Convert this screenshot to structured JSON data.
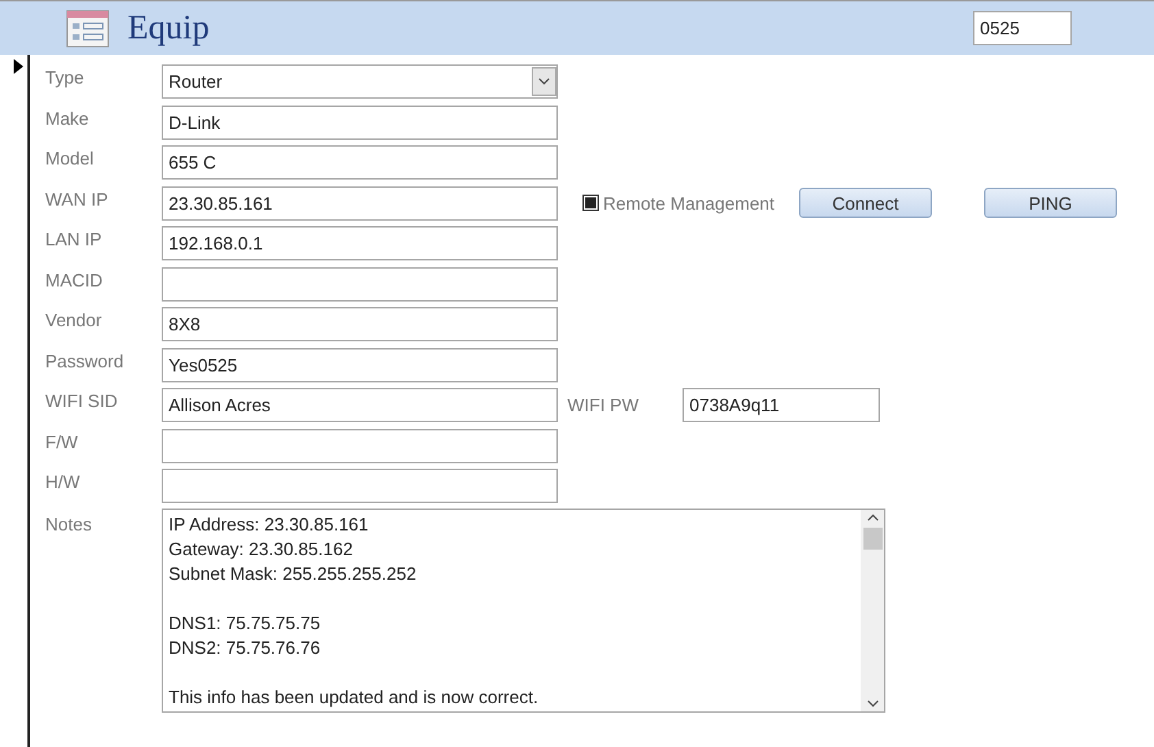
{
  "header": {
    "title": "Equip",
    "record_id": "0525"
  },
  "fields": [
    {
      "label": "Type",
      "kind": "combo",
      "value": "Router"
    },
    {
      "label": "Make",
      "kind": "text",
      "value": "D-Link"
    },
    {
      "label": "Model",
      "kind": "text",
      "value": "655 C"
    },
    {
      "label": "WAN IP",
      "kind": "text",
      "value": "23.30.85.161",
      "extra": {
        "kind": "actions",
        "checkbox": {
          "label": "Remote Management",
          "checked": true
        },
        "buttons": [
          "Connect",
          "PING"
        ]
      }
    },
    {
      "label": "LAN IP",
      "kind": "text",
      "value": "192.168.0.1"
    },
    {
      "label": "MACID",
      "kind": "text"
    },
    {
      "label": "Vendor",
      "kind": "text",
      "value": "8X8"
    },
    {
      "label": "Password",
      "kind": "text",
      "value": "Yes0525"
    },
    {
      "label": "WIFI SID",
      "kind": "text",
      "value": "Allison Acres",
      "extra": {
        "kind": "field",
        "label": "WIFI PW",
        "value": "0738A9q11"
      }
    },
    {
      "label": "F/W",
      "kind": "text"
    },
    {
      "label": "H/W",
      "kind": "text"
    }
  ],
  "notes": {
    "label": "Notes",
    "paragraphs": [
      [
        "IP Address: 23.30.85.161",
        "Gateway: 23.30.85.162",
        "Subnet Mask: 255.255.255.252"
      ],
      [
        "DNS1: 75.75.75.75",
        "DNS2: 75.75.76.76"
      ],
      [
        "This info has been updated and is now correct."
      ]
    ]
  }
}
